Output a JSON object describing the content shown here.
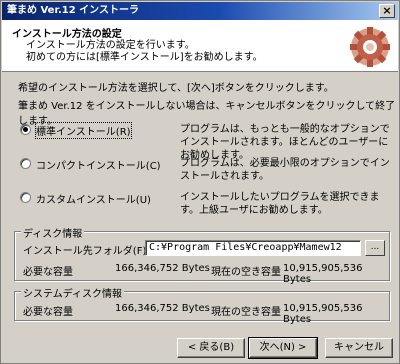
{
  "window": {
    "title": "筆まめ Ver.12 インストーラ",
    "close_glyph": "×"
  },
  "header": {
    "title": "インストール方法の設定",
    "desc_line1": "インストール方法の設定を行います。",
    "desc_line2": "初めての方には[標準インストール]をお勧めします。",
    "icon": "gear-icon"
  },
  "intro": {
    "line1": "希望のインストール方法を選択して、[次へ]ボタンをクリックします。",
    "line2": "筆まめ Ver.12 をインストールしない場合は、キャンセルボタンをクリックして終了します。"
  },
  "options": [
    {
      "label": "標準インストール(R)",
      "desc": "プログラムは、もっとも一般的なオプションでインストールされます。ほとんどのユーザーにお勧めします。",
      "checked": true
    },
    {
      "label": "コンパクトインストール(C)",
      "desc": "プログラムは、必要最小限のオプションでインストールされます。",
      "checked": false
    },
    {
      "label": "カスタムインストール(U)",
      "desc": "インストールしたいプログラムを選択できます。上級ユーザにお勧めします。",
      "checked": false
    }
  ],
  "disk": {
    "title": "ディスク情報",
    "folder_label": "インストール先フォルダ(F)",
    "folder_value": "C:¥Program Files¥Creoapp¥Mamew12",
    "browse": "...",
    "required_label": "必要な容量",
    "required_value": "166,346,752 Bytes",
    "free_label": "現在の空き容量",
    "free_value": "10,915,905,536 Bytes"
  },
  "system_disk": {
    "title": "システムディスク情報",
    "required_label": "必要な容量",
    "required_value": "166,346,752 Bytes",
    "free_label": "現在の空き容量",
    "free_value": "10,915,905,536 Bytes"
  },
  "buttons": {
    "back": "< 戻る(B)",
    "next": "次へ(N) >",
    "cancel": "キャンセル"
  }
}
